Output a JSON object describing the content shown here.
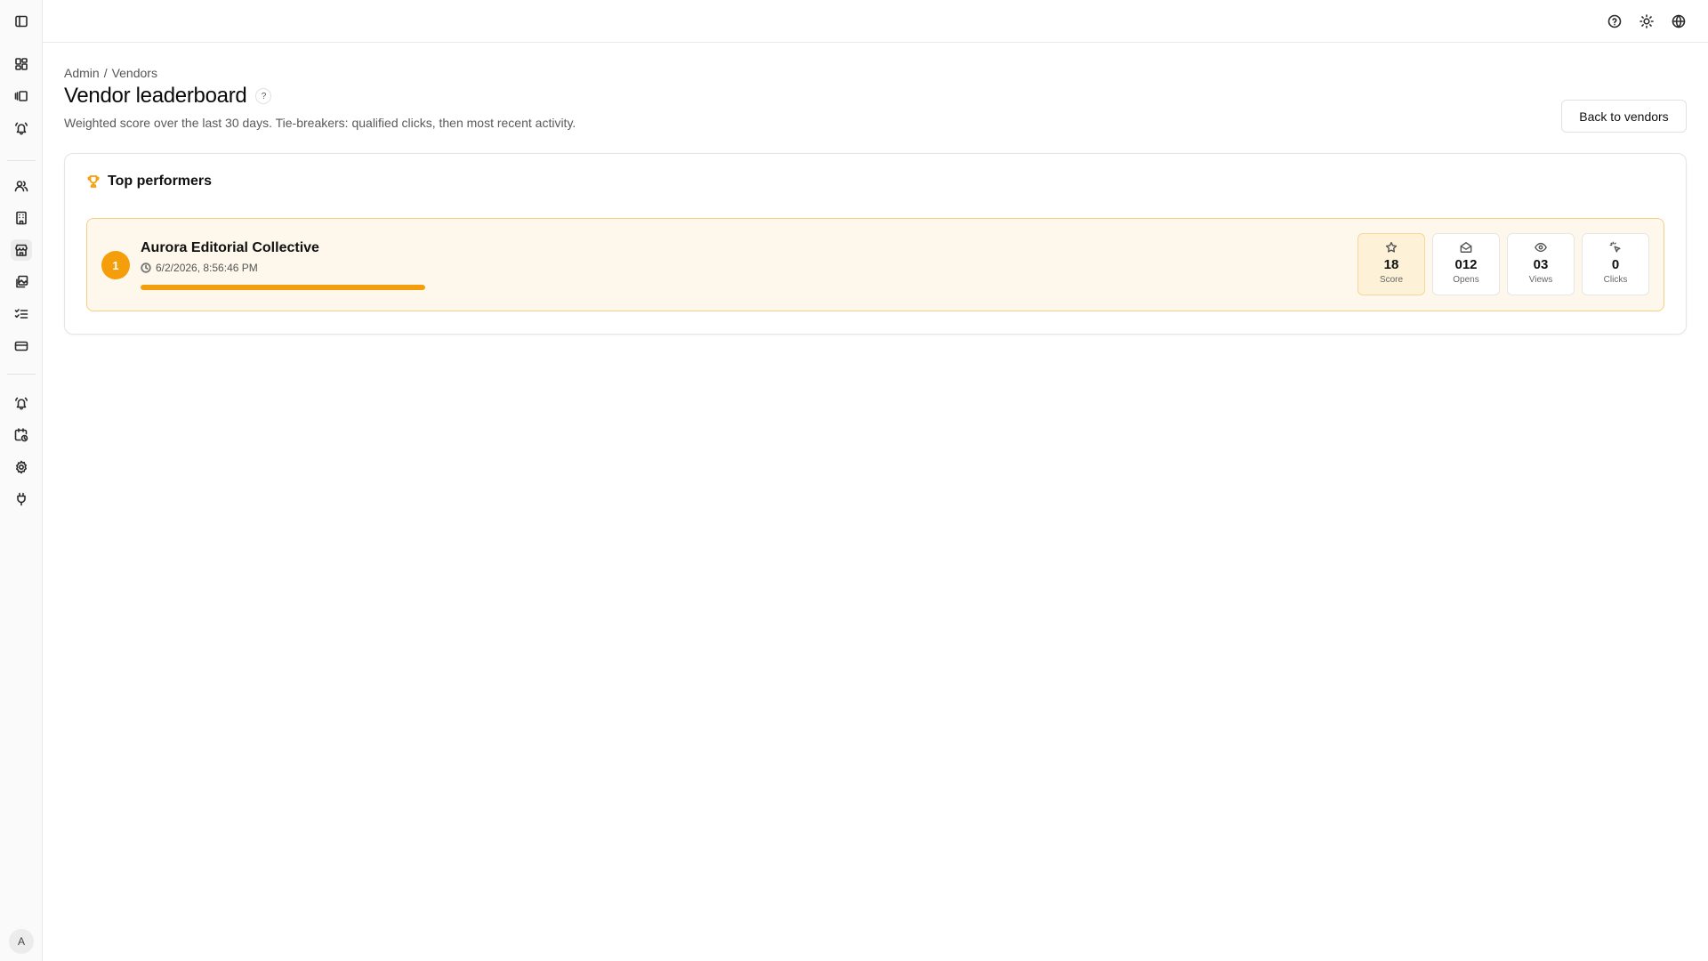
{
  "sidebar": {
    "items": [
      {
        "icon": "dashboard-icon"
      },
      {
        "icon": "gallery-icon"
      },
      {
        "icon": "bell-ring-icon"
      },
      {
        "icon": "users-icon"
      },
      {
        "icon": "building-icon"
      },
      {
        "icon": "store-icon"
      },
      {
        "icon": "images-icon"
      },
      {
        "icon": "checklist-icon"
      },
      {
        "icon": "credit-card-icon"
      },
      {
        "icon": "bell-ring-icon"
      },
      {
        "icon": "calendar-clock-icon"
      },
      {
        "icon": "gear-icon"
      },
      {
        "icon": "plug-icon"
      }
    ],
    "active_item": "store-icon",
    "avatar_initial": "A"
  },
  "topbar": {
    "icons": [
      "help-circle-icon",
      "sun-icon",
      "globe-icon"
    ]
  },
  "breadcrumb": {
    "root": "Admin",
    "separator": "/",
    "current": "Vendors"
  },
  "header": {
    "title": "Vendor leaderboard",
    "help_label": "?",
    "subtitle": "Weighted score over the last 30 days. Tie-breakers: qualified clicks, then most recent activity.",
    "back_label": "Back to vendors"
  },
  "leaderboard": {
    "title": "Top performers",
    "accent_color": "#f59e0b",
    "entries": [
      {
        "rank": "1",
        "name": "Aurora Editorial Collective",
        "timestamp": "6/2/2026, 8:56:46 PM",
        "progress_percent": 100,
        "stats": [
          {
            "icon": "star-icon",
            "value": "18",
            "label": "Score"
          },
          {
            "icon": "mail-open-icon",
            "value": "012",
            "label": "Opens"
          },
          {
            "icon": "eye-icon",
            "value": "03",
            "label": "Views"
          },
          {
            "icon": "pointer-click-icon",
            "value": "0",
            "label": "Clicks"
          }
        ]
      }
    ]
  }
}
